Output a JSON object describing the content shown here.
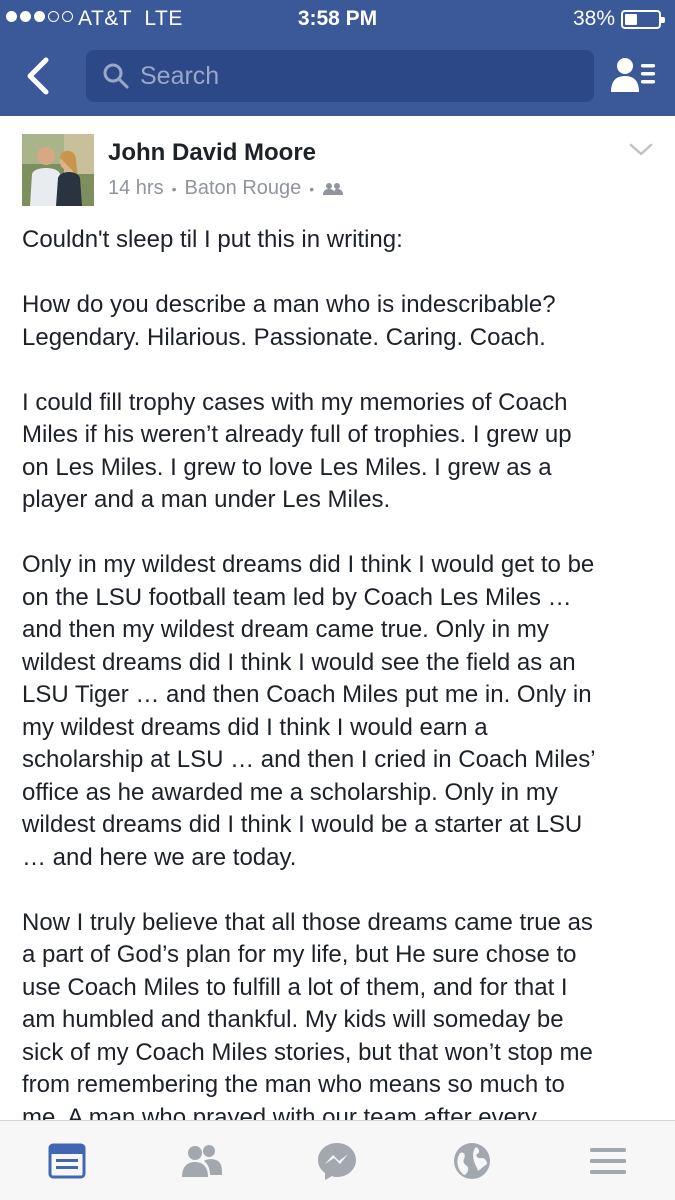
{
  "status": {
    "carrier": "AT&T  LTE",
    "time": "3:58 PM",
    "battery": "38%",
    "battery_level": 0.38
  },
  "nav": {
    "search_placeholder": "Search"
  },
  "post": {
    "author": "John David Moore",
    "time_ago": "14 hrs",
    "location": "Baton Rouge",
    "paragraphs": [
      [
        "Couldn't sleep til I put this in writing:"
      ],
      [
        "How do you describe a man who is indescribable?",
        "Legendary. Hilarious. Passionate. Caring. Coach."
      ],
      [
        "I could fill trophy cases with my memories of Coach",
        "Miles if his weren’t already full of trophies. I grew up",
        "on Les Miles. I grew to love Les Miles. I grew as a",
        "player and a man under Les Miles."
      ],
      [
        "Only in my wildest dreams did I think I would get to be",
        "on the LSU football team led by Coach Les Miles …",
        "and then my wildest dream came true. Only in my",
        "wildest dreams did I think I would see the field as an",
        "LSU Tiger … and then Coach Miles put me in. Only in",
        "my wildest dreams did I think I would earn a",
        "scholarship at LSU … and then I cried in Coach Miles’",
        "office as he awarded me a scholarship. Only in my",
        "wildest dreams did I think I would be a starter at LSU",
        "… and here we are today."
      ],
      [
        "Now I truly believe that all those dreams came true as",
        "a part of God’s plan for my life, but He sure chose to",
        "use Coach Miles to fulfill a lot of them, and for that I",
        "am humbled and thankful. My kids will someday be",
        "sick of my Coach Miles stories, but that won’t stop me",
        "from remembering the man who means so much to",
        "me. A man who prayed with our team after every"
      ]
    ]
  },
  "tabs": [
    {
      "icon": "news-feed-icon",
      "active": true
    },
    {
      "icon": "friends-icon",
      "active": false
    },
    {
      "icon": "messenger-icon",
      "active": false
    },
    {
      "icon": "notifications-globe-icon",
      "active": false
    },
    {
      "icon": "menu-icon",
      "active": false
    }
  ],
  "colors": {
    "brand": "#3b5998",
    "active_tab": "#4267b2",
    "inactive_tab": "#a3a7ae"
  }
}
